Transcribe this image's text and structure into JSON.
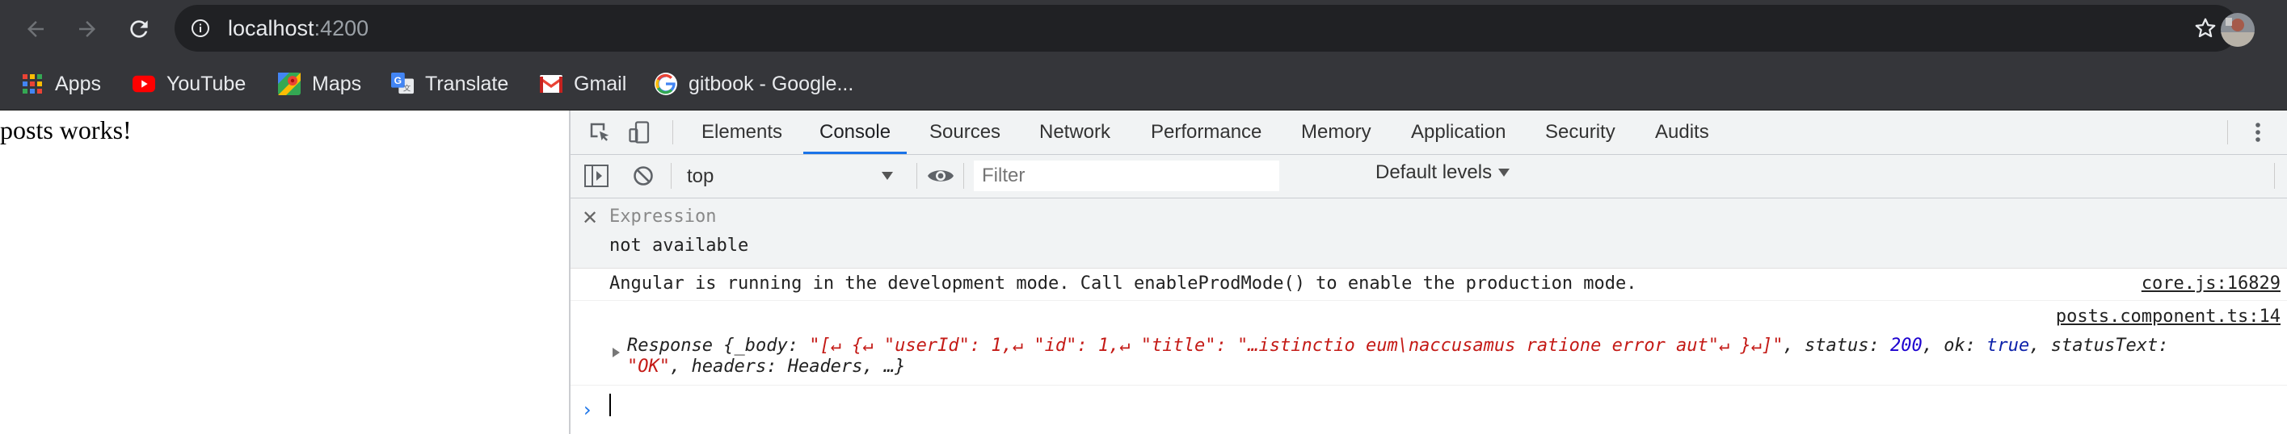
{
  "browser": {
    "url_host": "localhost",
    "url_port": ":4200",
    "bookmarks": [
      {
        "label": "Apps",
        "icon": "apps-grid-icon"
      },
      {
        "label": "YouTube",
        "icon": "youtube-icon"
      },
      {
        "label": "Maps",
        "icon": "maps-icon"
      },
      {
        "label": "Translate",
        "icon": "translate-icon"
      },
      {
        "label": "Gmail",
        "icon": "gmail-icon"
      },
      {
        "label": "gitbook - Google...",
        "icon": "google-icon"
      }
    ]
  },
  "page": {
    "text": "posts works!"
  },
  "devtools": {
    "tabs": [
      "Elements",
      "Console",
      "Sources",
      "Network",
      "Performance",
      "Memory",
      "Application",
      "Security",
      "Audits"
    ],
    "active_tab": "Console",
    "context": "top",
    "filter_placeholder": "Filter",
    "levels": "Default levels",
    "expression": {
      "label": "Expression",
      "value": "not available"
    },
    "messages": [
      {
        "text": "Angular is running in the development mode. Call enableProdMode() to enable the production mode.",
        "source": "core.js:16829"
      },
      {
        "source": "posts.component.ts:14",
        "obj_label": "Response",
        "body_key": "_body",
        "body_value": "\"[↵  {↵    \"userId\": 1,↵    \"id\": 1,↵    \"title\": \"…istinctio eum\\naccusamus ratione error aut\"↵  }↵]\"",
        "status_key": "status",
        "status_value": "200",
        "ok_key": "ok",
        "ok_value": "true",
        "statusText_key": "statusText",
        "statusText_value": "\"OK\"",
        "headers_key": "headers",
        "headers_value": "Headers, …}"
      }
    ]
  },
  "colors": {
    "chrome_bg": "#35363a",
    "omnibox_bg": "#202124",
    "active_tab_underline": "#1a73e8",
    "string": "#c41a16",
    "number": "#1c00cf"
  }
}
